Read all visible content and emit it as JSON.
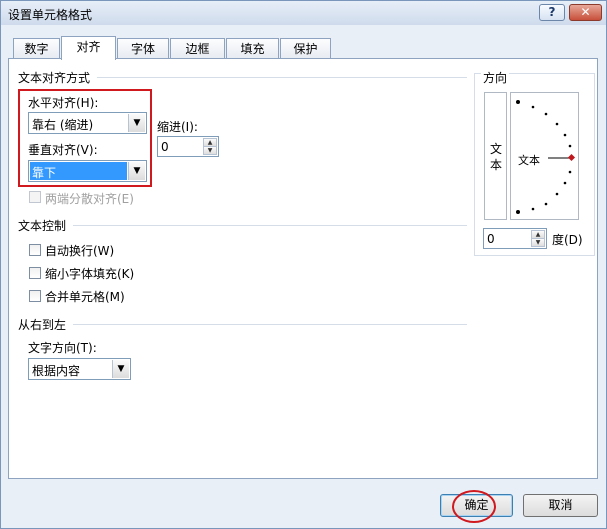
{
  "window": {
    "title": "设置单元格格式",
    "help_label": "?",
    "close_label": "✕"
  },
  "tabs": [
    {
      "label": "数字"
    },
    {
      "label": "对齐"
    },
    {
      "label": "字体"
    },
    {
      "label": "边框"
    },
    {
      "label": "填充"
    },
    {
      "label": "保护"
    }
  ],
  "active_tab": "对齐",
  "text_alignment": {
    "section_title": "文本对齐方式",
    "horizontal_label": "水平对齐(H):",
    "horizontal_value": "靠右 (缩进)",
    "vertical_label": "垂直对齐(V):",
    "vertical_value": "靠下",
    "indent_label": "缩进(I):",
    "indent_value": "0",
    "distributed_label": "两端分散对齐(E)"
  },
  "text_control": {
    "section_title": "文本控制",
    "options": [
      {
        "label": "自动换行(W)",
        "checked": false
      },
      {
        "label": "缩小字体填充(K)",
        "checked": false
      },
      {
        "label": "合并单元格(M)",
        "checked": false
      }
    ]
  },
  "rtl": {
    "section_title": "从右到左",
    "direction_label": "文字方向(T):",
    "direction_value": "根据内容"
  },
  "orientation": {
    "section_title": "方向",
    "vertical_text": "文本",
    "dial_text": "文本",
    "degrees_value": "0",
    "degrees_label": "度(D)"
  },
  "footer": {
    "ok_label": "确定",
    "cancel_label": "取消"
  },
  "colors": {
    "highlight": "#d0181f",
    "selection": "#3399ff"
  }
}
